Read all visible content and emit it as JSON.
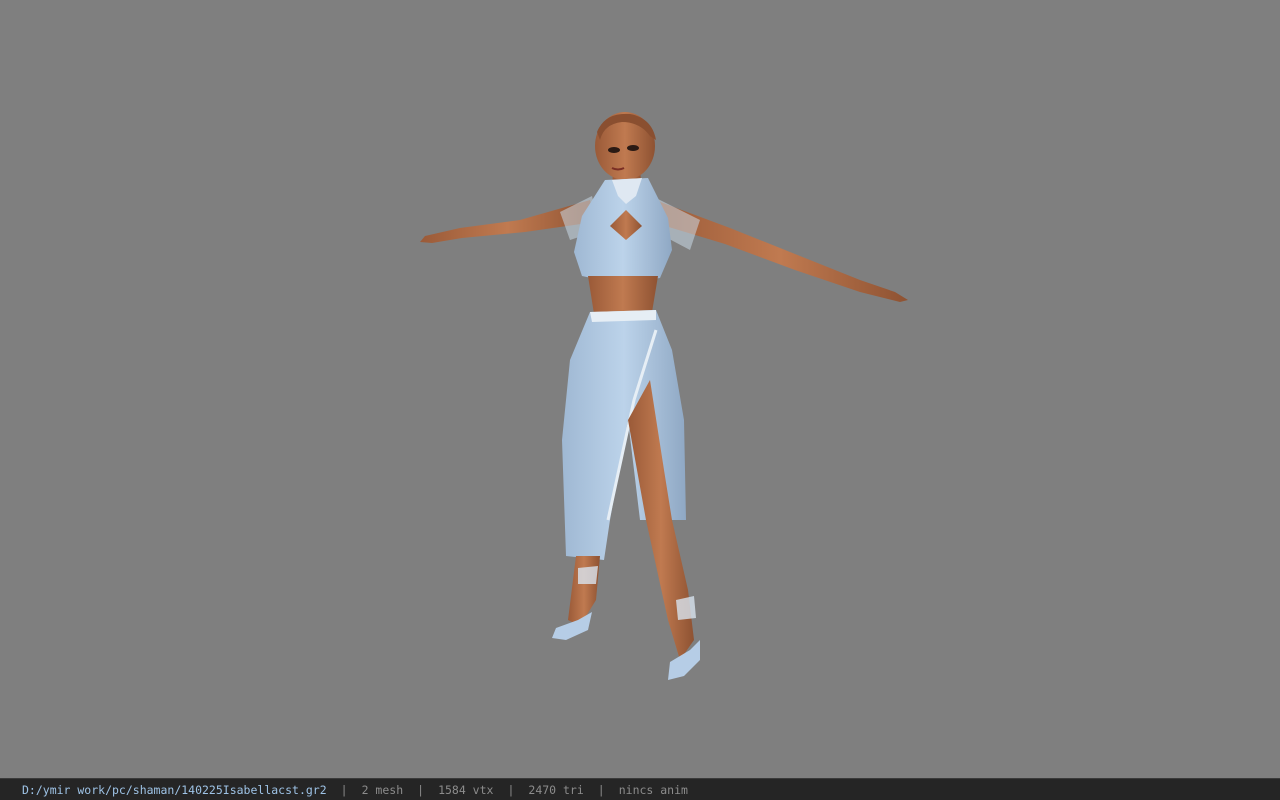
{
  "viewer": {
    "background_color": "#7f7f7f",
    "model_description_colors": {
      "skin": "#b8714a",
      "dress": "#a8c4e0",
      "trim": "#e6eef5"
    }
  },
  "statusbar": {
    "file_path": "D:/ymir work/pc/shaman/140225Isabellacst.gr2",
    "separator": "|",
    "mesh_count": "2 mesh",
    "vertex_count": "1584 vtx",
    "triangle_count": "2470 tri",
    "animation": "nincs anim"
  }
}
